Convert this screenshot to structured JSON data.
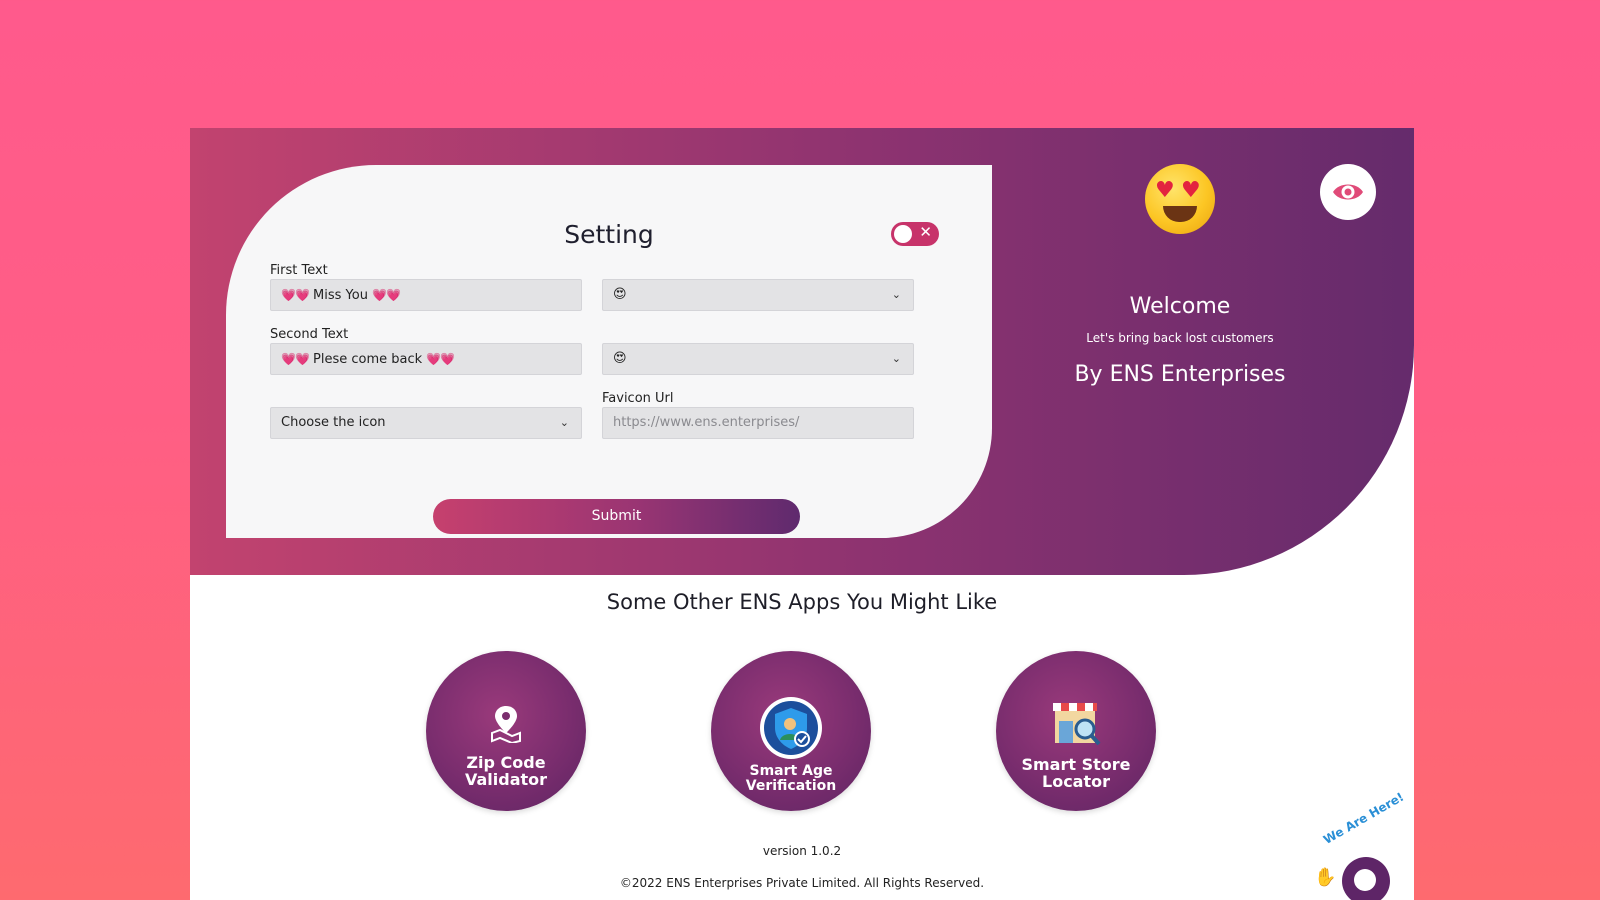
{
  "settings": {
    "title": "Setting",
    "toggle_state": "off",
    "first_text": {
      "label": "First Text",
      "value": "Miss You",
      "emoji_select": "😍"
    },
    "second_text": {
      "label": "Second Text",
      "value": "Plese come back",
      "emoji_select": "😍"
    },
    "icon_select": {
      "value": "Choose the icon"
    },
    "favicon": {
      "label": "Favicon Url",
      "placeholder": "https://www.ens.enterprises/"
    },
    "submit_label": "Submit"
  },
  "hero": {
    "welcome": "Welcome",
    "subtitle": "Let's bring back lost customers",
    "byline": "By ENS Enterprises"
  },
  "apps": {
    "title": "Some Other ENS Apps You Might Like",
    "items": [
      {
        "line1": "Zip Code",
        "line2": "Validator",
        "icon": "map-pin-icon"
      },
      {
        "line1": "Smart Age",
        "line2": "Verification",
        "icon": "shield-user-icon"
      },
      {
        "line1": "Smart Store",
        "line2": "Locator",
        "icon": "store-search-icon"
      }
    ]
  },
  "footer": {
    "version": "version 1.0.2",
    "copyright": "©2022 ENS Enterprises Private Limited. All Rights Reserved."
  },
  "chat": {
    "label": "We Are Here!"
  },
  "colors": {
    "background": "#ff5a8c",
    "hero_start": "#c2436f",
    "hero_end": "#652b6c",
    "accent": "#c7336a"
  }
}
